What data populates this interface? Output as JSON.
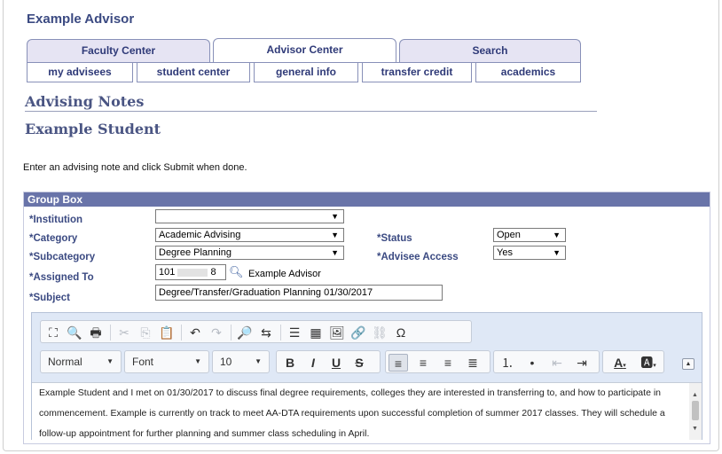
{
  "app_title": "Example Advisor",
  "tabs": [
    {
      "label": "Faculty Center"
    },
    {
      "label": "Advisor Center"
    },
    {
      "label": "Search"
    }
  ],
  "subtabs": [
    {
      "label": "my advisees"
    },
    {
      "label": "student center"
    },
    {
      "label": "general info"
    },
    {
      "label": "transfer credit"
    },
    {
      "label": "academics"
    }
  ],
  "page_heading": "Advising Notes",
  "student_name": "Example Student",
  "instructions": "Enter an advising note and click Submit when done.",
  "group_box": {
    "title": "Group Box",
    "institution": {
      "label": "*Institution",
      "value": ""
    },
    "category": {
      "label": "*Category",
      "value": "Academic Advising"
    },
    "subcategory": {
      "label": "*Subcategory",
      "value": "Degree Planning"
    },
    "assigned_to": {
      "label": "*Assigned To",
      "id_prefix": "101",
      "id_suffix": "8",
      "name": "Example Advisor"
    },
    "subject": {
      "label": "*Subject",
      "value": "Degree/Transfer/Graduation Planning 01/30/2017"
    },
    "status": {
      "label": "*Status",
      "value": "Open"
    },
    "advisee_access": {
      "label": "*Advisee Access",
      "value": "Yes"
    }
  },
  "editor": {
    "format_combo": "Normal",
    "font_combo": "Font",
    "size_combo": "10",
    "toolbar_row1_icons": [
      "maximize-icon",
      "preview-icon",
      "print-icon",
      "cut-icon",
      "copy-icon",
      "paste-icon",
      "undo-icon",
      "redo-icon",
      "find-icon",
      "replace-icon",
      "horizontal-line-icon",
      "table-icon",
      "image-icon",
      "link-icon",
      "unlink-icon",
      "special-char-icon"
    ],
    "glyphs": {
      "maximize": "⛶",
      "preview": "🔍",
      "print": "🖶",
      "cut": "✂",
      "copy": "⎘",
      "paste": "📋",
      "undo": "↶",
      "redo": "↷",
      "find": "🔎",
      "replace": "⇆",
      "hline": "☰",
      "table": "▦",
      "image": "🖼",
      "link": "🔗",
      "unlink": "⛓",
      "omega": "Ω",
      "bold": "B",
      "italic": "I",
      "underline": "U",
      "strike": "S",
      "align_left": "≡",
      "align_center": "≡",
      "align_right": "≡",
      "justify": "≣",
      "ol": "⒈",
      "ul": "•",
      "outdent": "⇤",
      "indent": "⇥",
      "font_color": "A",
      "bg_color": "🅰"
    },
    "body_text": "Example Student and I met on 01/30/2017 to discuss final degree requirements, colleges they are interested in transferring to, and how to participate in commencement. Example is currently on track to meet AA-DTA requirements upon successful completion of summer 2017 classes. They will schedule a follow-up appointment for further planning and summer class scheduling in April."
  }
}
